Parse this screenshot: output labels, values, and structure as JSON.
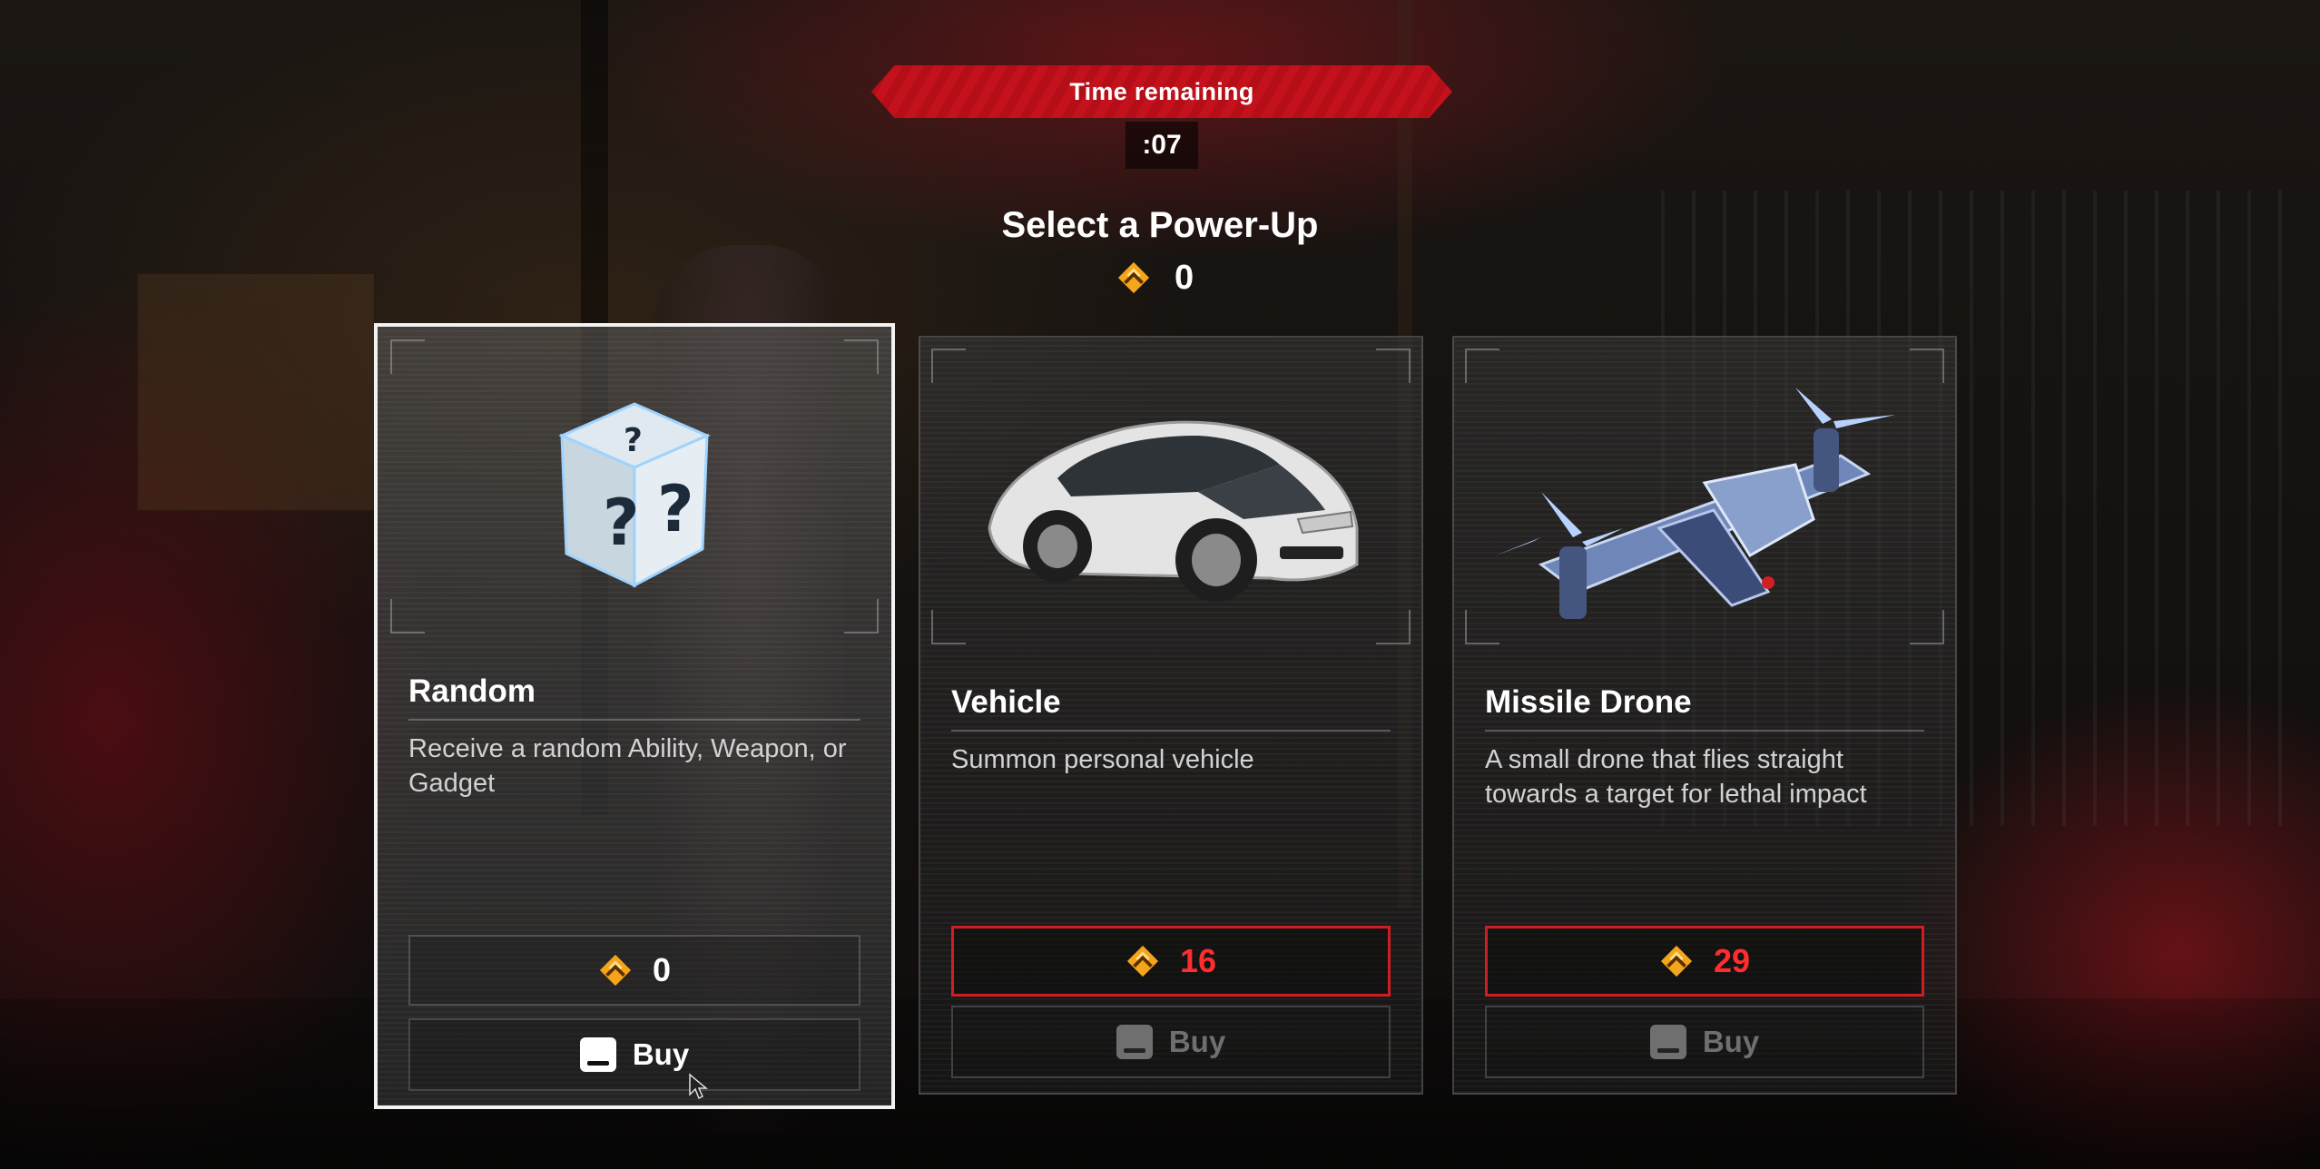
{
  "timer": {
    "label": "Time remaining",
    "value": ":07"
  },
  "header": {
    "title": "Select a Power-Up",
    "currency_balance": "0"
  },
  "colors": {
    "accent_red": "#d01d22",
    "timer_red": "#c3121c",
    "coin_gold": "#f4a51c",
    "selected_border": "#f2f2f2"
  },
  "cards": [
    {
      "title": "Random",
      "description": "Receive a random Ability, Weapon, or Gadget",
      "price": "0",
      "buy_label": "Buy",
      "icon": "mystery-dice-icon"
    },
    {
      "title": "Vehicle",
      "description": "Summon personal vehicle",
      "price": "16",
      "buy_label": "Buy",
      "icon": "car-icon"
    },
    {
      "title": "Missile Drone",
      "description": "A small drone that flies straight towards a target for lethal impact",
      "price": "29",
      "buy_label": "Buy",
      "icon": "drone-icon"
    }
  ]
}
